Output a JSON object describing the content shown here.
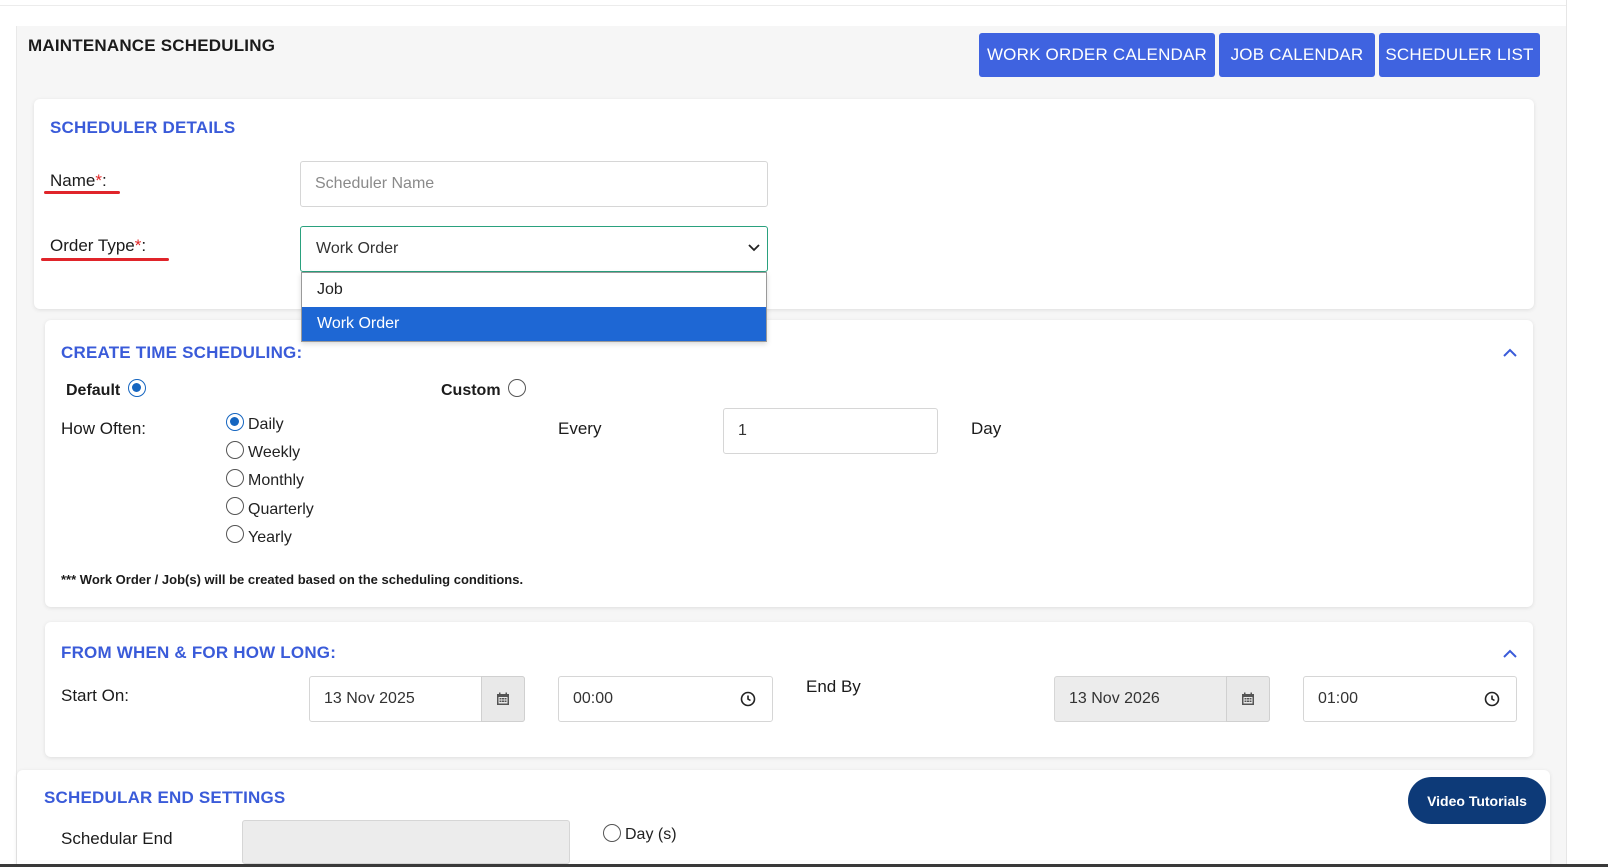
{
  "header": {
    "title": "MAINTENANCE SCHEDULING",
    "buttons": {
      "work_order_calendar": "WORK ORDER CALENDAR",
      "job_calendar": "JOB CALENDAR",
      "scheduler_list": "SCHEDULER LIST"
    }
  },
  "scheduler_details": {
    "title": "SCHEDULER DETAILS",
    "name_label": "Name",
    "name_placeholder": "Scheduler Name",
    "order_type_label": "Order Type",
    "required_mark": "*",
    "label_colon": ":",
    "order_type_value": "Work Order",
    "order_type_options": [
      "Job",
      "Work Order"
    ],
    "order_type_selected_index": 1
  },
  "time_scheduling": {
    "title": "CREATE TIME SCHEDULING:",
    "default_label": "Default",
    "default_checked": true,
    "custom_label": "Custom",
    "custom_checked": false,
    "how_often_label": "How Often:",
    "frequency_options": [
      "Daily",
      "Weekly",
      "Monthly",
      "Quarterly",
      "Yearly"
    ],
    "frequency_selected": "Daily",
    "every_label": "Every",
    "every_value": "1",
    "unit_label": "Day",
    "note": "*** Work Order / Job(s) will be created based on the scheduling conditions."
  },
  "from_when": {
    "title": "FROM WHEN & FOR HOW LONG:",
    "start_label": "Start On:",
    "start_date": "13 Nov 2025",
    "start_time": "00:00",
    "end_label": "End By",
    "end_date": "13 Nov 2026",
    "end_time": "01:00"
  },
  "end_settings": {
    "title": "SCHEDULAR END SETTINGS",
    "end_label": "Schedular End",
    "day_option_label": "Day (s)"
  },
  "video_tutorials": "Video Tutorials",
  "colors": {
    "primary_button": "#3f63e0",
    "section_title": "#3a5bd9",
    "required": "#e02424",
    "dropdown_selected": "#1e67d4",
    "video_button": "#0d3a78"
  }
}
